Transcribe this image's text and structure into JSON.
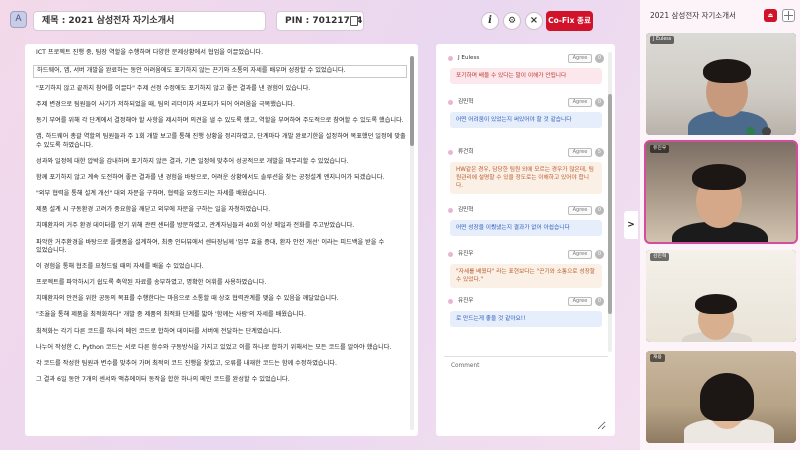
{
  "topbar": {
    "logo_glyph": "A",
    "title": "제목 : 2021 삼성전자 자기소개서",
    "pin": "PIN :  70121764",
    "info_icon": "i",
    "share_icon": "⚙",
    "close_icon": "×",
    "cofix_label": "Co-Fix 종료"
  },
  "document": {
    "paragraphs": [
      "ICT 프로젝트 진행 중, 팀장 역할을 수행하며 다양한 문제상황에서 협업을 이끌었습니다.",
      "하드웨어, 앱, 서버 개발을 완료하는 동안 어려움에도 포기하지 않는 끈기와 소통의 자세를 배우며 성장할 수 있었습니다.",
      "\"포기하지 않고 끝까지 참여를 이끌다\" 주제 선정 수정에도 포기하지 않고 좋은 결과를 낸 경험이 있습니다.",
      "주제 변경으로 팀원들이 사기가 저하되었을 때, 팀의 리더이자 서포터가 되어 어려움을 극복했습니다.",
      "동기 부여를 위해 각 단계에서 결정해야 할 사항을 제시하며 의견을 낼 수 있도록 했고, 역할을 부여하여 주도적으로 참여할 수 있도록 했습니다.",
      "앱, 하드웨어 총괄 역할의 팀원들과 주 1회 개발 보고를 통해 진행 상황을 정리하였고, 단계마다 개발 완료기한을 설정하여 목표했던 일정에 맞출 수 있도록 하였습니다.",
      "성과와 일정에 대한 압박을 감내하며 포기하지 않은 결과, 기존 일정에 맞추어 성공적으로 개발을 마무리할 수 있었습니다.",
      "함께 포기하지 않고 계속 도전하여 좋은 결과를 낸 경험을 바탕으로, 어려운 상황에서도 솔루션을 찾는 공정설계 엔지니어가 되겠습니다.",
      "\"외부 협력을 통해 설계 개선\" 대외 자문을 구하며, 협력을 요청드리는 자세를 배웠습니다.",
      "제품 설계 시 구동환경 고려가 중요함을 깨닫고 외부에 자문을 구하는 일을 자청하였습니다.",
      "치매환자의 거주 환경 데이터를 얻기 위해 관련 센터를 방문하였고, 관계자님들과 40회 이상 메일과 전화를 주고받았습니다.",
      "파악한 거주환경을 바탕으로 플랫폼을 설계하여, 최종 인터뷰에서 센터장님께 '업무 효율 증대, 환자 안전 개선' 이라는 피드백을 받을 수 있었습니다.",
      "이 경험을 통해 협조를 요청드릴 때의 자세를 배울 수 있었습니다.",
      "프로젝트를 파악하시기 쉽도록 축약된 자료를 송부하였고, 명확한 어휘를 사용하였습니다.",
      "치매환자의 안전을 위한 공동의 목표를 수행한다는 마음으로 소통할 때 상호 협력관계를 맺을 수 있음을 깨달았습니다.",
      "\"조율을 통해 제품을 최적화하다\" 개발 중 제품의 최적화 단계를 밟아 '함께는 사람'의 자세를 배웠습니다.",
      "최적화는 각기 다른 코드를 하나의 메인 코드로 합하여 데이터를 서버에 전달하는 단계였습니다.",
      "나누어 작성한 C, Python 코드는 서로 다른 함수와 구동방식을 가지고 있었고 이를 하나로 합하기 위해서는 모든 코드를 알아야 했습니다.",
      "각 코드를 작성한 팀원과 변수를 맞추어 가며 최적의 코드 진행을 찾았고, 오류를 내재한 코드는 함께 수정하였습니다.",
      "그 결과 6일 동안 7개의 센서와 액츄에이터 동작을 합한 하나의 메인 코드를 완성할 수 있었습니다."
    ]
  },
  "comments": {
    "agree_label": "Agree",
    "items": [
      {
        "author": "J Euless",
        "count": "0",
        "text": "포기하며 배울 수 있다는 말이 이해가 안됩니다"
      },
      {
        "author": "김민혁",
        "count": "0",
        "text": "어떤 어려움이 있었는지 써있어야 할 것 같습니다"
      },
      {
        "author": "류건희",
        "count": "5",
        "text": "HW같은 경우, 담당한 팀원 외에 모르는 경우가 많은데, 팀원관리에 설명할 수 있을 정도로는 이해하고 있어야 합니다."
      },
      {
        "author": "김민혁",
        "count": "0",
        "text": "어떤 성장을 이뤘냈는지 결과가 없어 아쉽습니다"
      },
      {
        "author": "유진우",
        "count": "0",
        "text": "\"자세를 배웠다\" 라는 표현보다는 \"끈기와 소통으로 성장할 수 있었다.\""
      },
      {
        "author": "유진우",
        "count": "0",
        "text": "로 만드는게 좋을 것 같아요!!"
      }
    ],
    "comment_label": "Comment"
  },
  "video": {
    "title": "2021 삼성전자 자기소개서",
    "exit_icon": "⏏",
    "participants": [
      {
        "name": "J Euless"
      },
      {
        "name": "유진우"
      },
      {
        "name": "김민혁"
      },
      {
        "name": "유진우"
      },
      {
        "name": "재용"
      }
    ]
  },
  "collapse_glyph": ">",
  "colors": {
    "accent": "#d0122b",
    "active_frame": "#d24d9a",
    "background": "#f3d9ea"
  }
}
